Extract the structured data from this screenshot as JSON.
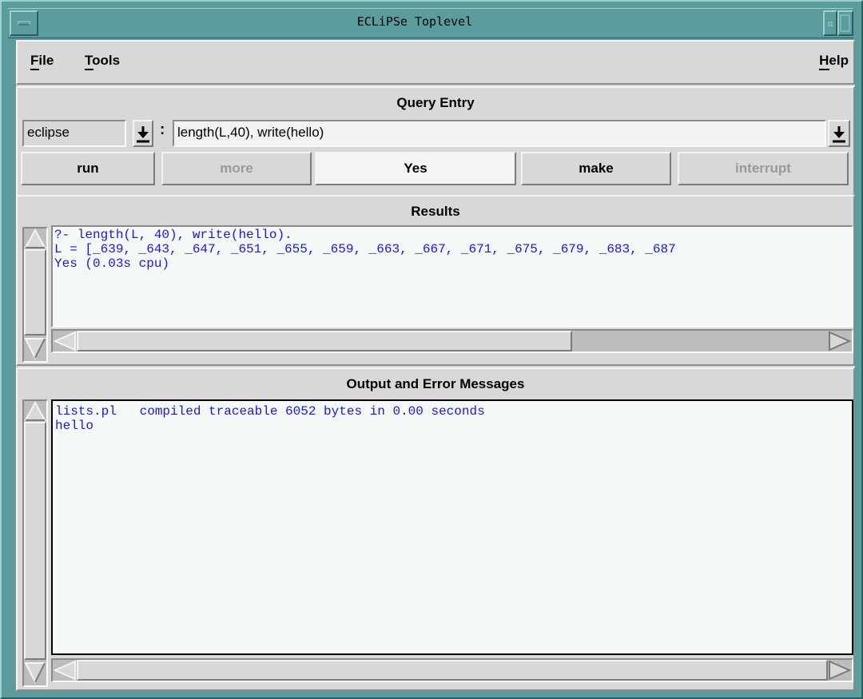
{
  "window": {
    "title": "ECLiPSe Toplevel"
  },
  "menubar": {
    "file": "File",
    "tools": "Tools",
    "help": "Help"
  },
  "query": {
    "section_title": "Query Entry",
    "module": "eclipse",
    "separator": ":",
    "goal": "length(L,40), write(hello)",
    "buttons": {
      "run": "run",
      "more": "more",
      "yes": "Yes",
      "make": "make",
      "interrupt": "interrupt"
    }
  },
  "results": {
    "section_title": "Results",
    "lines": [
      "?- length(L, 40), write(hello).",
      "L = [_639, _643, _647, _651, _655, _659, _663, _667, _671, _675, _679, _683, _687",
      "Yes (0.03s cpu)"
    ]
  },
  "output": {
    "section_title": "Output and Error Messages",
    "lines": [
      "lists.pl   compiled traceable 6052 bytes in 0.00 seconds",
      "hello"
    ]
  },
  "colors": {
    "frame": "#5b9c9c",
    "panel": "#d8d8d8",
    "text_output": "#1818ee"
  },
  "icons": {
    "minimize": "minimize-icon",
    "maximize": "maximize-icon",
    "window_menu": "window-menu-icon",
    "dropdown": "dropdown-arrow-icon"
  }
}
